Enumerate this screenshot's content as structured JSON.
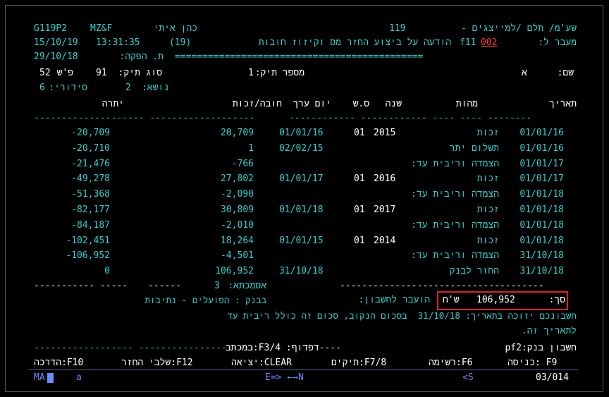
{
  "header": {
    "code": "G119P2",
    "company": "MZ&F",
    "user_name": "כהן איתי",
    "screen_number": "119",
    "screen_title": "שע'מ/ תלם /למייצגים -",
    "date": "15/10/19",
    "time": "13:31:35",
    "notice_num": "(19)",
    "notice_text": "הודעה על ביצוע החזר מס וקיזוז חובות",
    "function_key": "f11",
    "transfer_label": "מעבר ל:",
    "transfer_value": "002",
    "produce_date": "29/10/18",
    "produce_label": "ת. הפקה:",
    "separator": "============================================="
  },
  "file_info": {
    "name_label": "שם:",
    "name_value": "א",
    "file_num_label": "מספר תיק:",
    "file_num_value": "1",
    "file_type_label": "סוג תיק:",
    "file_type_value": "91",
    "ps_label": "פ'ש",
    "ps_value": "52",
    "subject_label": "נושא:",
    "subject_value": "2",
    "serial_label": "סידורי:",
    "serial_value": "6"
  },
  "table": {
    "columns": [
      "תאריך",
      "מהות",
      "שנה",
      "ס.ש",
      "יום ערך",
      "חובה/זכות",
      "יתרה"
    ],
    "underline_right": "------------ ------------ ---- ---- --------",
    "underline_left": "-------------------- -------------------",
    "rows": [
      {
        "date": "01/01/16",
        "desc": "זכות",
        "year": "2015",
        "ss": "01",
        "value_date": "01/01/16",
        "amount": "20,709",
        "balance": "-20,709"
      },
      {
        "date": "01/01/16",
        "desc": "תשלום יתר",
        "year": "",
        "ss": "",
        "value_date": "02/02/15",
        "amount": "1",
        "balance": "-20,710"
      },
      {
        "date": "01/01/17",
        "desc": "הצמדה וריבית עד:",
        "year": "",
        "ss": "",
        "value_date": "",
        "amount": "-766",
        "balance": "-21,476"
      },
      {
        "date": "01/01/17",
        "desc": "זכות",
        "year": "2016",
        "ss": "01",
        "value_date": "01/01/17",
        "amount": "27,802",
        "balance": "-49,278"
      },
      {
        "date": "01/01/18",
        "desc": "הצמדה וריבית עד:",
        "year": "",
        "ss": "",
        "value_date": "",
        "amount": "-2,090",
        "balance": "-51,368"
      },
      {
        "date": "01/01/18",
        "desc": "זכות",
        "year": "2017",
        "ss": "01",
        "value_date": "01/01/18",
        "amount": "30,809",
        "balance": "-82,177"
      },
      {
        "date": "01/01/18",
        "desc": "הצמדה וריבית עד:",
        "year": "",
        "ss": "",
        "value_date": "",
        "amount": "-2,010",
        "balance": "-84,187"
      },
      {
        "date": "01/01/18",
        "desc": "זכות",
        "year": "2014",
        "ss": "01",
        "value_date": "01/01/15",
        "amount": "18,264",
        "balance": "-102,451"
      },
      {
        "date": "31/10/18",
        "desc": "הצמדה וריבית עד:",
        "year": "",
        "ss": "",
        "value_date": "",
        "amount": "-4,501",
        "balance": "-106,952"
      },
      {
        "date": "31/10/18",
        "desc": "החזר לבנק",
        "year": "",
        "ss": "",
        "value_date": "31/10/18",
        "amount": "106,952",
        "balance": "0"
      }
    ]
  },
  "totals": {
    "dashes_right": "-------------------------------------",
    "dashes_mid": "------",
    "dashes_left": "----------- -----",
    "asmachta_label": "אסמכתא:",
    "asmachta_value": "3",
    "sum_label": "סך:",
    "sum_value": "106,952",
    "sum_currency": "ש'ח",
    "transfer_text": "הועבר לחשבון:",
    "bank_text": "בבנק : הפועלים - נתיבות",
    "note_line1": "חשבונכם יזוכה בתאריך: 31/10/18  בסכום הנקוב, סכום זה כולל ריבית עד",
    "note_line2": "לתאריך זה.",
    "bank_account_label": "חשבון בנק:pf2",
    "dfdof": "----דפדוף: F3/4:במכתב",
    "bottom_dashes_left": "------------------ ---------------------"
  },
  "fkeys": {
    "f9": "כניסה: F9",
    "f6": "רשימה:F6",
    "f78": "תיקים:F7/8",
    "clear": "יציאה:CLEAR",
    "f12": "שלבי החזר:F12",
    "f10": "הדרכה:F10"
  },
  "status": {
    "left": "MA",
    "mode": "a",
    "arrows": "E=> ←→N",
    "s": "<S",
    "page": "03/014"
  }
}
